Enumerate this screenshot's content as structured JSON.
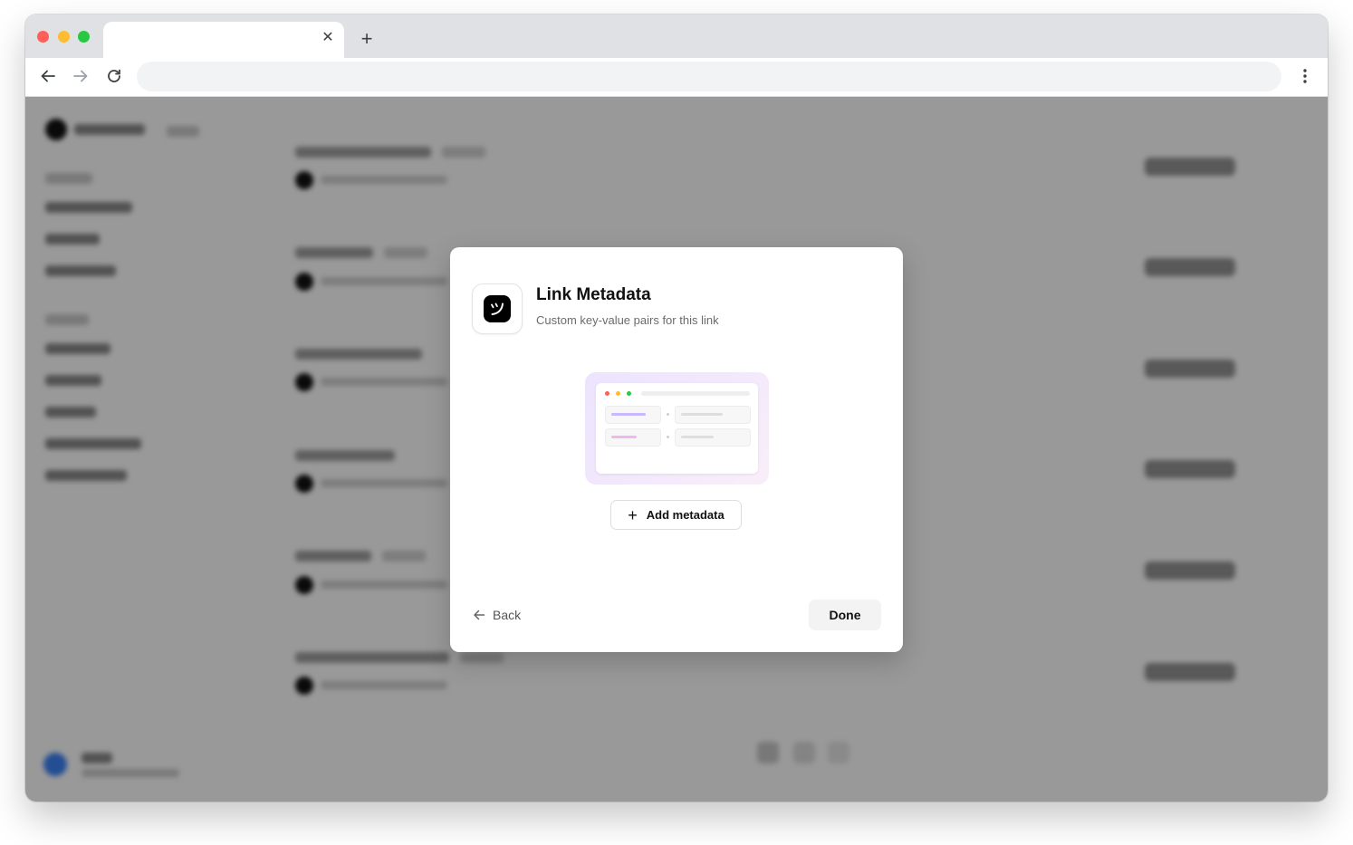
{
  "browser": {
    "tab": {
      "title": "",
      "close_icon": "close-icon"
    },
    "new_tab_icon": "plus-icon",
    "address_bar": {
      "value": ""
    }
  },
  "modal": {
    "logo_icon": "brand-logo-icon",
    "title": "Link Metadata",
    "subtitle": "Custom key-value pairs for this link",
    "illustration_icon": "metadata-illustration",
    "add_button_label": "Add metadata",
    "back_label": "Back",
    "done_label": "Done"
  },
  "colors": {
    "overlay": "#000000",
    "primary_text": "#111111",
    "secondary_text": "#6b6b6b",
    "illustration_bg": "#ece3ff"
  }
}
